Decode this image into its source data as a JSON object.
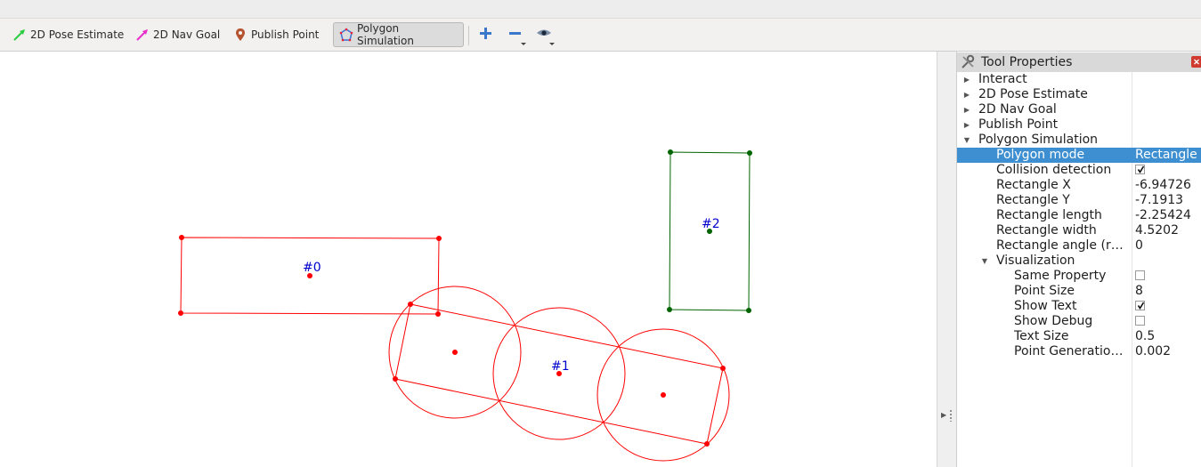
{
  "toolbar": {
    "tools": [
      {
        "label": "2D Pose Estimate",
        "icon": "green-arrow-icon",
        "color": "#2ecc40"
      },
      {
        "label": "2D Nav Goal",
        "icon": "magenta-arrow-icon",
        "color": "#e830c8"
      },
      {
        "label": "Publish Point",
        "icon": "map-pin-icon",
        "color": "#b5532f"
      },
      {
        "label": "Polygon Simulation",
        "icon": "polygon-icon",
        "color": "#3b6fd6"
      }
    ],
    "active_tool": "Polygon Simulation",
    "extras": [
      "add-tool-icon",
      "remove-tool-icon",
      "eye-icon"
    ]
  },
  "viewport": {
    "labels": {
      "poly0": "#0",
      "poly1": "#1",
      "poly2": "#2"
    },
    "colors": {
      "red": "#ff0000",
      "green": "#006400",
      "label": "#0000cc"
    }
  },
  "panel": {
    "title": "Tool Properties",
    "rows": [
      {
        "name": "Interact",
        "value": "",
        "depth": 0,
        "expand": "collapsed"
      },
      {
        "name": "2D Pose Estimate",
        "value": "",
        "depth": 0,
        "expand": "collapsed"
      },
      {
        "name": "2D Nav Goal",
        "value": "",
        "depth": 0,
        "expand": "collapsed"
      },
      {
        "name": "Publish Point",
        "value": "",
        "depth": 0,
        "expand": "collapsed"
      },
      {
        "name": "Polygon Simulation",
        "value": "",
        "depth": 0,
        "expand": "expanded"
      },
      {
        "name": "Polygon mode",
        "value": "Rectangle",
        "depth": 1,
        "selected": true
      },
      {
        "name": "Collision detection",
        "value": "",
        "depth": 1,
        "checkbox": true,
        "checked": true
      },
      {
        "name": "Rectangle X",
        "value": "-6.94726",
        "depth": 1
      },
      {
        "name": "Rectangle Y",
        "value": "-7.1913",
        "depth": 1
      },
      {
        "name": "Rectangle length",
        "value": "-2.25424",
        "depth": 1
      },
      {
        "name": "Rectangle width",
        "value": "4.5202",
        "depth": 1
      },
      {
        "name": "Rectangle angle (rad)",
        "value": "0",
        "depth": 1
      },
      {
        "name": "Visualization",
        "value": "",
        "depth": 1,
        "expand": "expanded"
      },
      {
        "name": "Same Property",
        "value": "",
        "depth": 2,
        "checkbox": true,
        "checked": false
      },
      {
        "name": "Point Size",
        "value": "8",
        "depth": 2
      },
      {
        "name": "Show Text",
        "value": "",
        "depth": 2,
        "checkbox": true,
        "checked": true
      },
      {
        "name": "Show Debug",
        "value": "",
        "depth": 2,
        "checkbox": true,
        "checked": false
      },
      {
        "name": "Text Size",
        "value": "0.5",
        "depth": 2
      },
      {
        "name": "Point Generatio…",
        "value": "0.002",
        "depth": 2
      }
    ],
    "selection_color": "#3d8fd1"
  }
}
